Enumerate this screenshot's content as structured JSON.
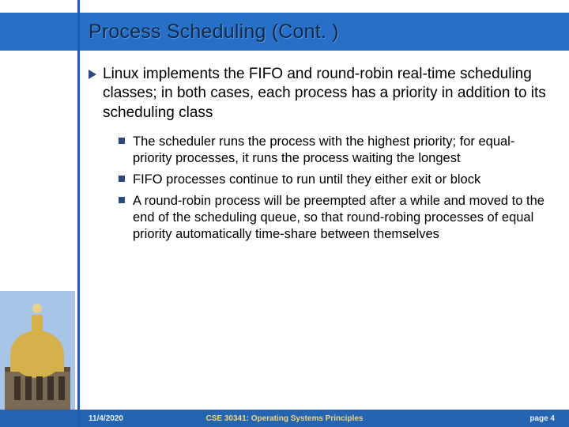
{
  "title": "Process Scheduling (Cont. )",
  "bullets": {
    "main": "Linux implements the FIFO and round-robin real-time scheduling classes; in both cases, each process has a priority in addition to its scheduling class",
    "subs": [
      "The scheduler runs the process with the highest priority; for equal-priority processes, it runs the process waiting the longest",
      "FIFO processes continue to run until they either exit or block",
      "A round-robin process will be preempted after a while and moved to the end of the scheduling queue, so that round-robing processes of equal priority automatically time-share between themselves"
    ]
  },
  "footer": {
    "date": "11/4/2020",
    "course": "CSE 30341: Operating Systems Principles",
    "page": "page 4"
  },
  "colors": {
    "title_bar": "#286fc8",
    "footer_bar": "#2564b0",
    "footer_course": "#f2d479"
  }
}
